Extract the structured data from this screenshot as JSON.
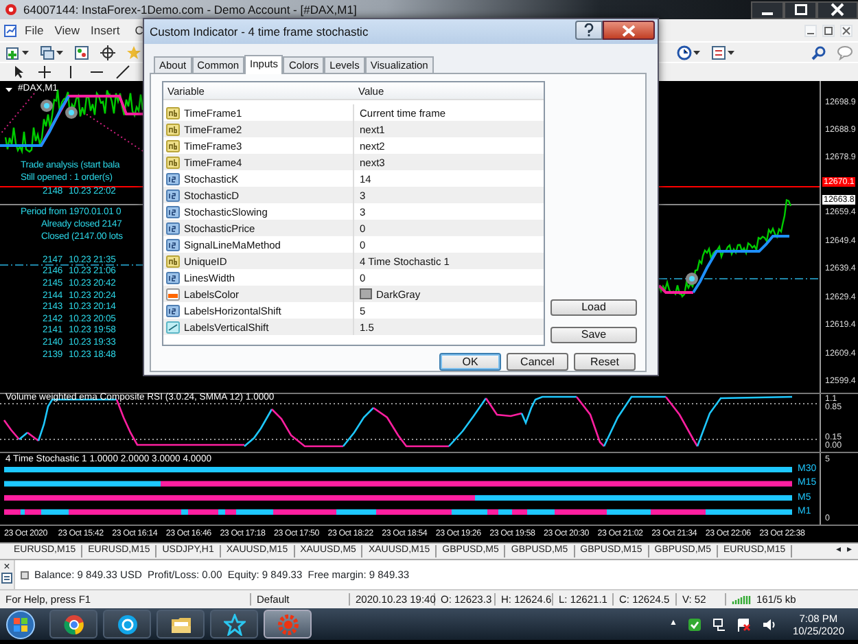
{
  "title_bar": {
    "title": "64007144: InstaForex-1Demo.com - Demo Account - [#DAX,M1]"
  },
  "menu": [
    "File",
    "View",
    "Insert",
    "C"
  ],
  "chart": {
    "symbol": "#DAX,M1",
    "analysis": [
      {
        "kind": "heading",
        "text": "Trade analysis (start bala"
      },
      {
        "kind": "heading",
        "text": "Still opened : 1 order(s)"
      }
    ],
    "open_orders": [
      {
        "ticket": "2148",
        "time": "10.23 22:02"
      }
    ],
    "period": [
      {
        "kind": "heading",
        "text": "Period from 1970.01.01 0"
      },
      {
        "kind": "detail",
        "text": "Already closed 2147"
      },
      {
        "kind": "detail",
        "text": "Closed (2147.00 lots"
      }
    ],
    "closed_orders": [
      {
        "ticket": "2147",
        "time": "10.23 21:35"
      },
      {
        "ticket": "2146",
        "time": "10.23 21:06"
      },
      {
        "ticket": "2145",
        "time": "10.23 20:42"
      },
      {
        "ticket": "2144",
        "time": "10.23 20:24"
      },
      {
        "ticket": "2143",
        "time": "10.23 20:14"
      },
      {
        "ticket": "2142",
        "time": "10.23 20:05"
      },
      {
        "ticket": "2141",
        "time": "10.23 19:58"
      },
      {
        "ticket": "2140",
        "time": "10.23 19:33"
      },
      {
        "ticket": "2139",
        "time": "10.23 18:48"
      }
    ],
    "price_ticks": [
      "12698.9",
      "12688.9",
      "12678.9",
      "12659.4",
      "12649.4",
      "12639.4",
      "12629.4",
      "12619.4",
      "12609.4",
      "12599.4"
    ],
    "price_markers": [
      {
        "kind": "alert",
        "label": "12670.1"
      },
      {
        "kind": "bid",
        "label": "12663.8"
      }
    ]
  },
  "rsi": {
    "title": "Volume weighted ema Composite RSI (3.0.24, SMMA 12) 1.0000",
    "levels": [
      "1.1",
      "0.85",
      "0.15",
      "0.00"
    ]
  },
  "stochastic": {
    "title": "4 Time Stochastic 1 1.0000 2.0000 3.0000 4.0000",
    "scale": [
      "5",
      "0"
    ],
    "rows": [
      "M30",
      "M15",
      "M5",
      "M1"
    ]
  },
  "time_axis": [
    "23 Oct 2020",
    "23 Oct 15:42",
    "23 Oct 16:14",
    "23 Oct 16:46",
    "23 Oct 17:18",
    "23 Oct 17:50",
    "23 Oct 18:22",
    "23 Oct 18:54",
    "23 Oct 19:26",
    "23 Oct 19:58",
    "23 Oct 20:30",
    "23 Oct 21:02",
    "23 Oct 21:34",
    "23 Oct 22:06",
    "23 Oct 22:38"
  ],
  "chart_tabs": [
    "EURUSD,M15",
    "EURUSD,M15",
    "USDJPY,H1",
    "XAUUSD,M15",
    "XAUUSD,M5",
    "XAUUSD,M15",
    "GBPUSD,M5",
    "GBPUSD,M5",
    "GBPUSD,M15",
    "GBPUSD,M5",
    "EURUSD,M15"
  ],
  "tab_arrows": [
    "◂",
    "▸"
  ],
  "terminal": {
    "close_glyph": "×",
    "summary": "Balance: 9 849.33 USD  Profit/Loss: 0.00  Equity: 9 849.33  Free margin: 9 849.33"
  },
  "status_bar": [
    "For Help, press F1",
    "Default",
    "2020.10.23 19:40",
    "O: 12623.3",
    "H: 12624.6",
    "L: 12621.1",
    "C: 12624.5",
    "V: 52",
    "161/5 kb"
  ],
  "taskbar": {
    "apps": [
      {
        "kind": "browser",
        "active": false
      },
      {
        "kind": "chat",
        "active": false
      },
      {
        "kind": "folder",
        "active": false
      },
      {
        "kind": "star",
        "active": false
      },
      {
        "kind": "gear",
        "active": true
      }
    ],
    "tray_arrow": "▲",
    "time": "7:08 PM",
    "date": "10/25/2020"
  },
  "dialog": {
    "title": "Custom Indicator - 4 time frame stochastic",
    "tabs": [
      {
        "label": "About",
        "selected": false
      },
      {
        "label": "Common",
        "selected": false
      },
      {
        "label": "Inputs",
        "selected": true
      },
      {
        "label": "Colors",
        "selected": false
      },
      {
        "label": "Levels",
        "selected": false
      },
      {
        "label": "Visualization",
        "selected": false
      }
    ],
    "columns": [
      "Variable",
      "Value"
    ],
    "rows": [
      {
        "kind": "string",
        "name": "TimeFrame1",
        "value": "Current time frame"
      },
      {
        "kind": "string",
        "name": "TimeFrame2",
        "value": "next1"
      },
      {
        "kind": "string",
        "name": "TimeFrame3",
        "value": "next2"
      },
      {
        "kind": "string",
        "name": "TimeFrame4",
        "value": "next3"
      },
      {
        "kind": "integer",
        "name": "StochasticK",
        "value": "14"
      },
      {
        "kind": "integer",
        "name": "StochasticD",
        "value": "3"
      },
      {
        "kind": "integer",
        "name": "StochasticSlowing",
        "value": "3"
      },
      {
        "kind": "integer",
        "name": "StochasticPrice",
        "value": "0"
      },
      {
        "kind": "integer",
        "name": "SignalLineMaMethod",
        "value": "0"
      },
      {
        "kind": "string",
        "name": "UniqueID",
        "value": "4 Time Stochastic 1"
      },
      {
        "kind": "integer",
        "name": "LinesWidth",
        "value": "0"
      },
      {
        "kind": "color",
        "name": "LabelsColor",
        "value": "DarkGray",
        "color": "#a9a9a9"
      },
      {
        "kind": "integer",
        "name": "LabelsHorizontalShift",
        "value": "5"
      },
      {
        "kind": "double",
        "name": "LabelsVerticalShift",
        "value": "1.5"
      }
    ],
    "side_buttons": [
      "Load",
      "Save"
    ],
    "buttons": [
      {
        "label": "OK",
        "default": true
      },
      {
        "label": "Cancel",
        "default": false
      },
      {
        "label": "Reset",
        "default": false
      }
    ]
  }
}
